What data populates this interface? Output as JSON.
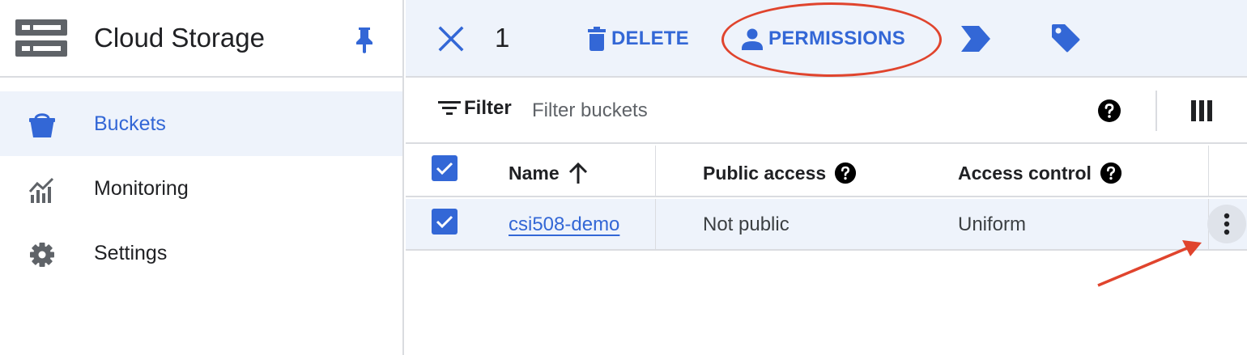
{
  "app": {
    "title": "Cloud Storage"
  },
  "sidebar": {
    "items": [
      {
        "label": "Buckets",
        "icon": "bucket-icon",
        "active": true
      },
      {
        "label": "Monitoring",
        "icon": "monitoring-icon",
        "active": false
      },
      {
        "label": "Settings",
        "icon": "gear-icon",
        "active": false
      }
    ]
  },
  "toolbar": {
    "selected_count": "1",
    "delete_label": "DELETE",
    "permissions_label": "PERMISSIONS"
  },
  "filter": {
    "label": "Filter",
    "placeholder": "Filter buckets"
  },
  "table": {
    "columns": {
      "name": "Name",
      "public_access": "Public access",
      "access_control": "Access control"
    },
    "rows": [
      {
        "name": "csi508-demo",
        "public_access": "Not public",
        "access_control": "Uniform",
        "checked": true
      }
    ]
  },
  "colors": {
    "accent": "#3367d6",
    "selected_bg": "#eef3fb",
    "annotation": "#e0442d"
  }
}
